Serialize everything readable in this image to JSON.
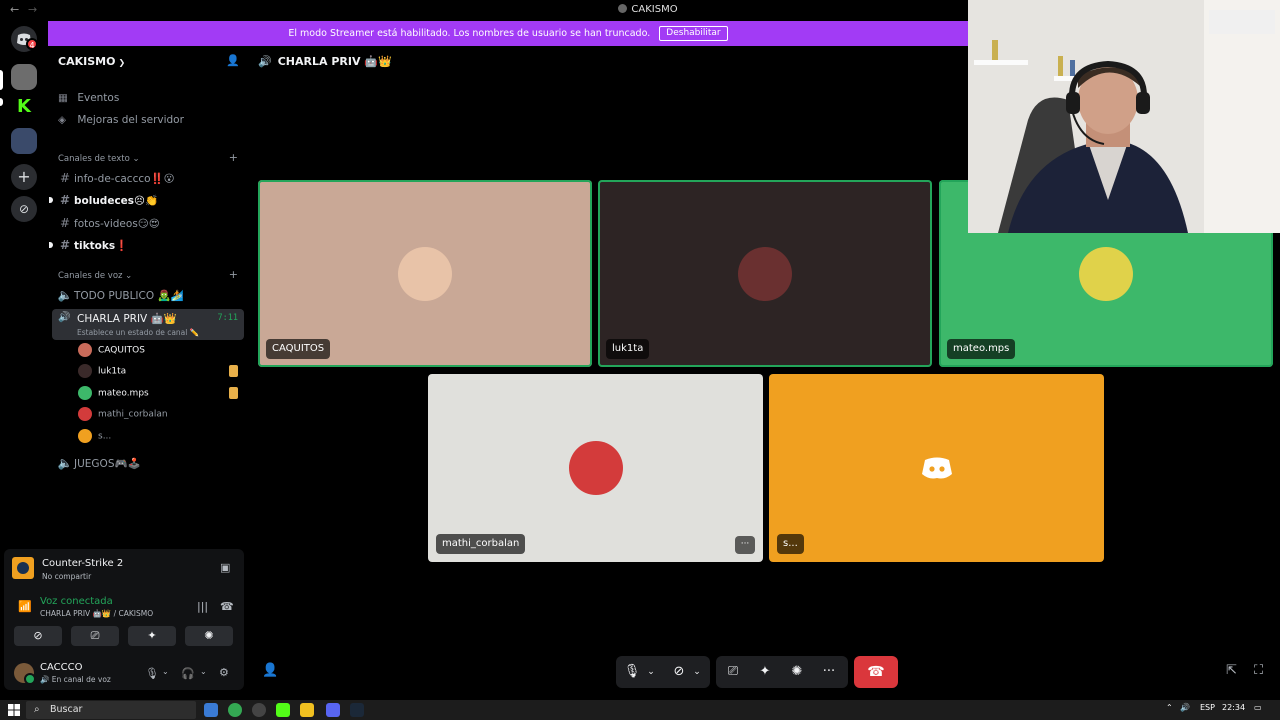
{
  "window": {
    "title": "CAKISMO"
  },
  "banner": {
    "text": "El modo Streamer está habilitado. Los nombres de usuario se han truncado.",
    "button": "Deshabilitar"
  },
  "server": {
    "name": "CAKISMO",
    "rows": [
      {
        "label": "Eventos"
      },
      {
        "label": "Mejoras del servidor"
      }
    ],
    "text_category": "Canales de texto",
    "text_channels": [
      {
        "name": "info-de-caccco‼️😮",
        "unread": false
      },
      {
        "name": "boludeces😣👏",
        "unread": true
      },
      {
        "name": "fotos-videos😏😍",
        "unread": false
      },
      {
        "name": "tiktoks❗",
        "unread": true
      }
    ],
    "voice_category": "Canales de voz",
    "voice_channels": [
      {
        "name": "TODO PUBLICO 🧟‍♂️🏄"
      },
      {
        "name": "CHARLA PRIV 🤖👑",
        "time": "7:11",
        "status": "Establece un estado de canal ✏️"
      },
      {
        "name": "JUEGOS🎮🕹️"
      }
    ],
    "voice_users": [
      {
        "name": "CAQUITOS",
        "live": false,
        "color": "#c96b5a"
      },
      {
        "name": "luk1ta",
        "live": true,
        "color": "#3a2a2a"
      },
      {
        "name": "mateo.mps",
        "live": true,
        "color": "#3db86a"
      },
      {
        "name": "mathi_corbalan",
        "live": false,
        "color": "#d33b3b"
      },
      {
        "name": "s...",
        "live": false,
        "color": "#f0a020"
      }
    ]
  },
  "activity": {
    "game": "Counter-Strike 2",
    "game_sub": "No compartir",
    "voice_title": "Voz conectada",
    "voice_sub": "CHARLA PRIV 🤖👑 / CAKISMO"
  },
  "user": {
    "name": "CACCCO",
    "status": "En canal de voz"
  },
  "stage": {
    "channel": "CHARLA PRIV 🤖👑",
    "tiles": [
      {
        "name": "CAQUITOS",
        "bg": "#c9a896",
        "speaking": true,
        "avatar_color": "#e8c3a8"
      },
      {
        "name": "luk1ta",
        "bg": "#2d2424",
        "speaking": true,
        "avatar_color": "#6a3030"
      },
      {
        "name": "mateo.mps",
        "bg": "#3db86a",
        "speaking": true,
        "avatar_color": "#e0d24a"
      },
      {
        "name": "mathi_corbalan",
        "bg": "#e0e0dc",
        "speaking": false,
        "avatar_color": "#d33b3b"
      },
      {
        "name": "s...",
        "bg": "#f0a020",
        "speaking": false,
        "avatar_color": ""
      }
    ],
    "more_label": "···"
  },
  "taskbar": {
    "search": "Buscar",
    "lang": "ESP",
    "time": "22:34"
  },
  "colors": {
    "accent": "#5865f2",
    "banner": "#a23bf5",
    "connected": "#23a55a",
    "danger": "#da373c"
  }
}
